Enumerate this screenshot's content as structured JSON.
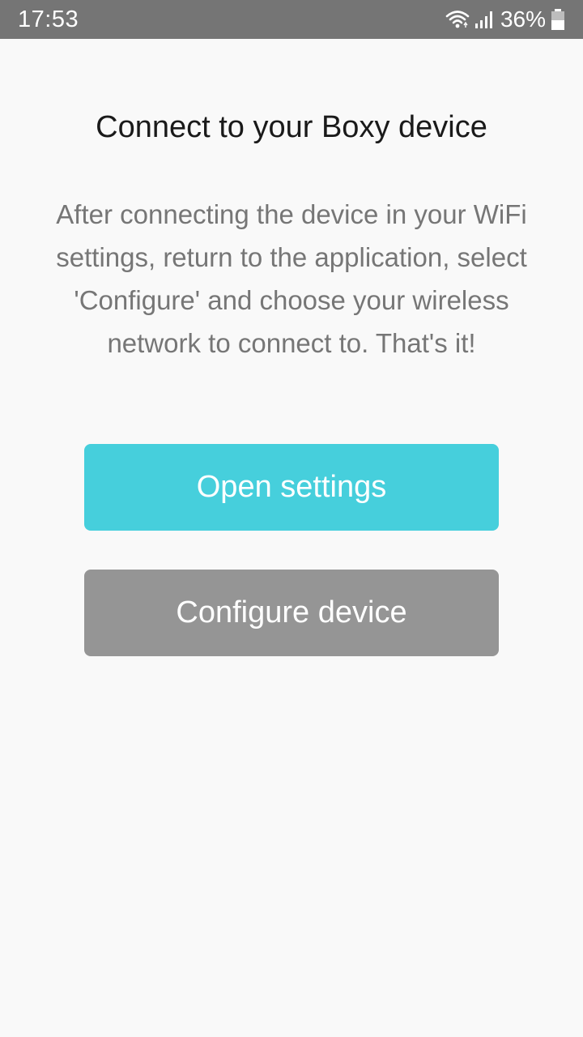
{
  "status_bar": {
    "time": "17:53",
    "battery_percent": "36%",
    "icons": [
      "wifi-icon",
      "signal-icon",
      "battery-icon"
    ]
  },
  "page": {
    "title": "Connect to your Boxy device",
    "description": "After connecting the device in your WiFi settings, return to the application, select 'Configure' and choose your wireless network to connect to. That's it!"
  },
  "buttons": {
    "open_settings": "Open settings",
    "configure_device": "Configure device"
  },
  "colors": {
    "status_bar": "#757575",
    "open_settings_button": "#46cfdc",
    "configure_device_button": "#959595",
    "background": "#f9f9f9"
  }
}
